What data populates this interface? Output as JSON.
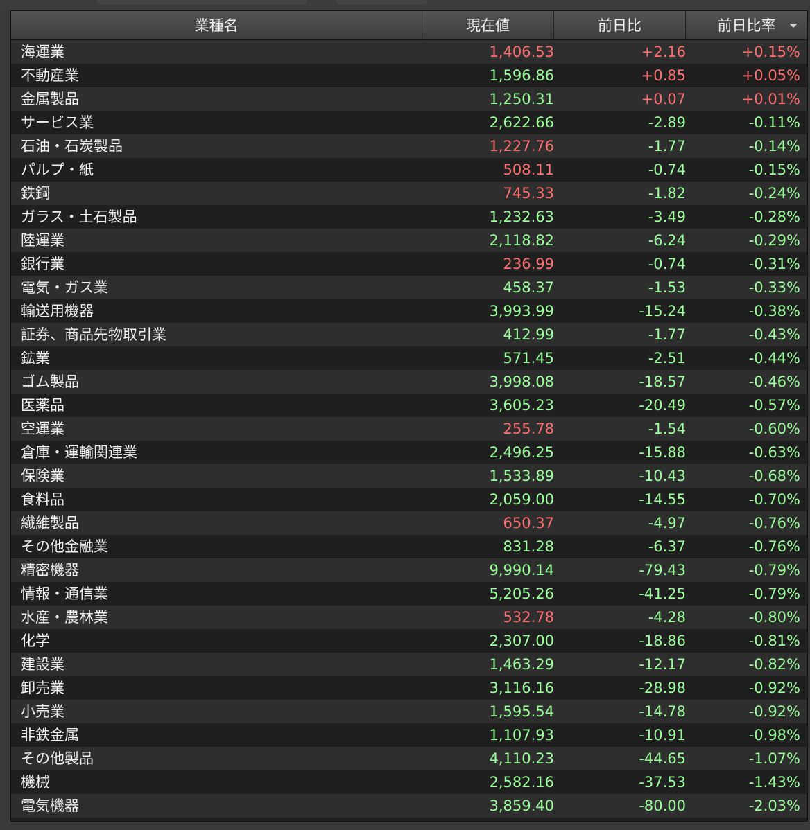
{
  "header": {
    "name": "業種名",
    "price": "現在値",
    "change": "前日比",
    "change_pct": "前日比率"
  },
  "colors": {
    "positive": "#ff7070",
    "negative": "#9cff9c",
    "header_bg": "#4a4a4a",
    "row_dark": "#1f1f1f",
    "row_light": "#2e2e2e"
  },
  "rows": [
    {
      "name": "海運業",
      "price": "1,406.53",
      "price_dir": "up",
      "change": "+2.16",
      "change_dir": "up",
      "pct": "+0.15%",
      "pct_dir": "up"
    },
    {
      "name": "不動産業",
      "price": "1,596.86",
      "price_dir": "down",
      "change": "+0.85",
      "change_dir": "up",
      "pct": "+0.05%",
      "pct_dir": "up"
    },
    {
      "name": "金属製品",
      "price": "1,250.31",
      "price_dir": "down",
      "change": "+0.07",
      "change_dir": "up",
      "pct": "+0.01%",
      "pct_dir": "up"
    },
    {
      "name": "サービス業",
      "price": "2,622.66",
      "price_dir": "down",
      "change": "-2.89",
      "change_dir": "down",
      "pct": "-0.11%",
      "pct_dir": "down"
    },
    {
      "name": "石油・石炭製品",
      "price": "1,227.76",
      "price_dir": "up",
      "change": "-1.77",
      "change_dir": "down",
      "pct": "-0.14%",
      "pct_dir": "down"
    },
    {
      "name": "パルプ・紙",
      "price": "508.11",
      "price_dir": "up",
      "change": "-0.74",
      "change_dir": "down",
      "pct": "-0.15%",
      "pct_dir": "down"
    },
    {
      "name": "鉄鋼",
      "price": "745.33",
      "price_dir": "up",
      "change": "-1.82",
      "change_dir": "down",
      "pct": "-0.24%",
      "pct_dir": "down"
    },
    {
      "name": "ガラス・土石製品",
      "price": "1,232.63",
      "price_dir": "down",
      "change": "-3.49",
      "change_dir": "down",
      "pct": "-0.28%",
      "pct_dir": "down"
    },
    {
      "name": "陸運業",
      "price": "2,118.82",
      "price_dir": "down",
      "change": "-6.24",
      "change_dir": "down",
      "pct": "-0.29%",
      "pct_dir": "down"
    },
    {
      "name": "銀行業",
      "price": "236.99",
      "price_dir": "up",
      "change": "-0.74",
      "change_dir": "down",
      "pct": "-0.31%",
      "pct_dir": "down"
    },
    {
      "name": "電気・ガス業",
      "price": "458.37",
      "price_dir": "down",
      "change": "-1.53",
      "change_dir": "down",
      "pct": "-0.33%",
      "pct_dir": "down"
    },
    {
      "name": "輸送用機器",
      "price": "3,993.99",
      "price_dir": "down",
      "change": "-15.24",
      "change_dir": "down",
      "pct": "-0.38%",
      "pct_dir": "down"
    },
    {
      "name": "証券、商品先物取引業",
      "price": "412.99",
      "price_dir": "down",
      "change": "-1.77",
      "change_dir": "down",
      "pct": "-0.43%",
      "pct_dir": "down"
    },
    {
      "name": "鉱業",
      "price": "571.45",
      "price_dir": "down",
      "change": "-2.51",
      "change_dir": "down",
      "pct": "-0.44%",
      "pct_dir": "down"
    },
    {
      "name": "ゴム製品",
      "price": "3,998.08",
      "price_dir": "down",
      "change": "-18.57",
      "change_dir": "down",
      "pct": "-0.46%",
      "pct_dir": "down"
    },
    {
      "name": "医薬品",
      "price": "3,605.23",
      "price_dir": "down",
      "change": "-20.49",
      "change_dir": "down",
      "pct": "-0.57%",
      "pct_dir": "down"
    },
    {
      "name": "空運業",
      "price": "255.78",
      "price_dir": "up",
      "change": "-1.54",
      "change_dir": "down",
      "pct": "-0.60%",
      "pct_dir": "down"
    },
    {
      "name": "倉庫・運輸関連業",
      "price": "2,496.25",
      "price_dir": "down",
      "change": "-15.88",
      "change_dir": "down",
      "pct": "-0.63%",
      "pct_dir": "down"
    },
    {
      "name": "保険業",
      "price": "1,533.89",
      "price_dir": "down",
      "change": "-10.43",
      "change_dir": "down",
      "pct": "-0.68%",
      "pct_dir": "down"
    },
    {
      "name": "食料品",
      "price": "2,059.00",
      "price_dir": "down",
      "change": "-14.55",
      "change_dir": "down",
      "pct": "-0.70%",
      "pct_dir": "down"
    },
    {
      "name": "繊維製品",
      "price": "650.37",
      "price_dir": "up",
      "change": "-4.97",
      "change_dir": "down",
      "pct": "-0.76%",
      "pct_dir": "down"
    },
    {
      "name": "その他金融業",
      "price": "831.28",
      "price_dir": "down",
      "change": "-6.37",
      "change_dir": "down",
      "pct": "-0.76%",
      "pct_dir": "down"
    },
    {
      "name": "精密機器",
      "price": "9,990.14",
      "price_dir": "down",
      "change": "-79.43",
      "change_dir": "down",
      "pct": "-0.79%",
      "pct_dir": "down"
    },
    {
      "name": "情報・通信業",
      "price": "5,205.26",
      "price_dir": "down",
      "change": "-41.25",
      "change_dir": "down",
      "pct": "-0.79%",
      "pct_dir": "down"
    },
    {
      "name": "水産・農林業",
      "price": "532.78",
      "price_dir": "up",
      "change": "-4.28",
      "change_dir": "down",
      "pct": "-0.80%",
      "pct_dir": "down"
    },
    {
      "name": "化学",
      "price": "2,307.00",
      "price_dir": "down",
      "change": "-18.86",
      "change_dir": "down",
      "pct": "-0.81%",
      "pct_dir": "down"
    },
    {
      "name": "建設業",
      "price": "1,463.29",
      "price_dir": "down",
      "change": "-12.17",
      "change_dir": "down",
      "pct": "-0.82%",
      "pct_dir": "down"
    },
    {
      "name": "卸売業",
      "price": "3,116.16",
      "price_dir": "down",
      "change": "-28.98",
      "change_dir": "down",
      "pct": "-0.92%",
      "pct_dir": "down"
    },
    {
      "name": "小売業",
      "price": "1,595.54",
      "price_dir": "down",
      "change": "-14.78",
      "change_dir": "down",
      "pct": "-0.92%",
      "pct_dir": "down"
    },
    {
      "name": "非鉄金属",
      "price": "1,107.93",
      "price_dir": "down",
      "change": "-10.91",
      "change_dir": "down",
      "pct": "-0.98%",
      "pct_dir": "down"
    },
    {
      "name": "その他製品",
      "price": "4,110.23",
      "price_dir": "down",
      "change": "-44.65",
      "change_dir": "down",
      "pct": "-1.07%",
      "pct_dir": "down"
    },
    {
      "name": "機械",
      "price": "2,582.16",
      "price_dir": "down",
      "change": "-37.53",
      "change_dir": "down",
      "pct": "-1.43%",
      "pct_dir": "down"
    },
    {
      "name": "電気機器",
      "price": "3,859.40",
      "price_dir": "down",
      "change": "-80.00",
      "change_dir": "down",
      "pct": "-2.03%",
      "pct_dir": "down"
    }
  ]
}
